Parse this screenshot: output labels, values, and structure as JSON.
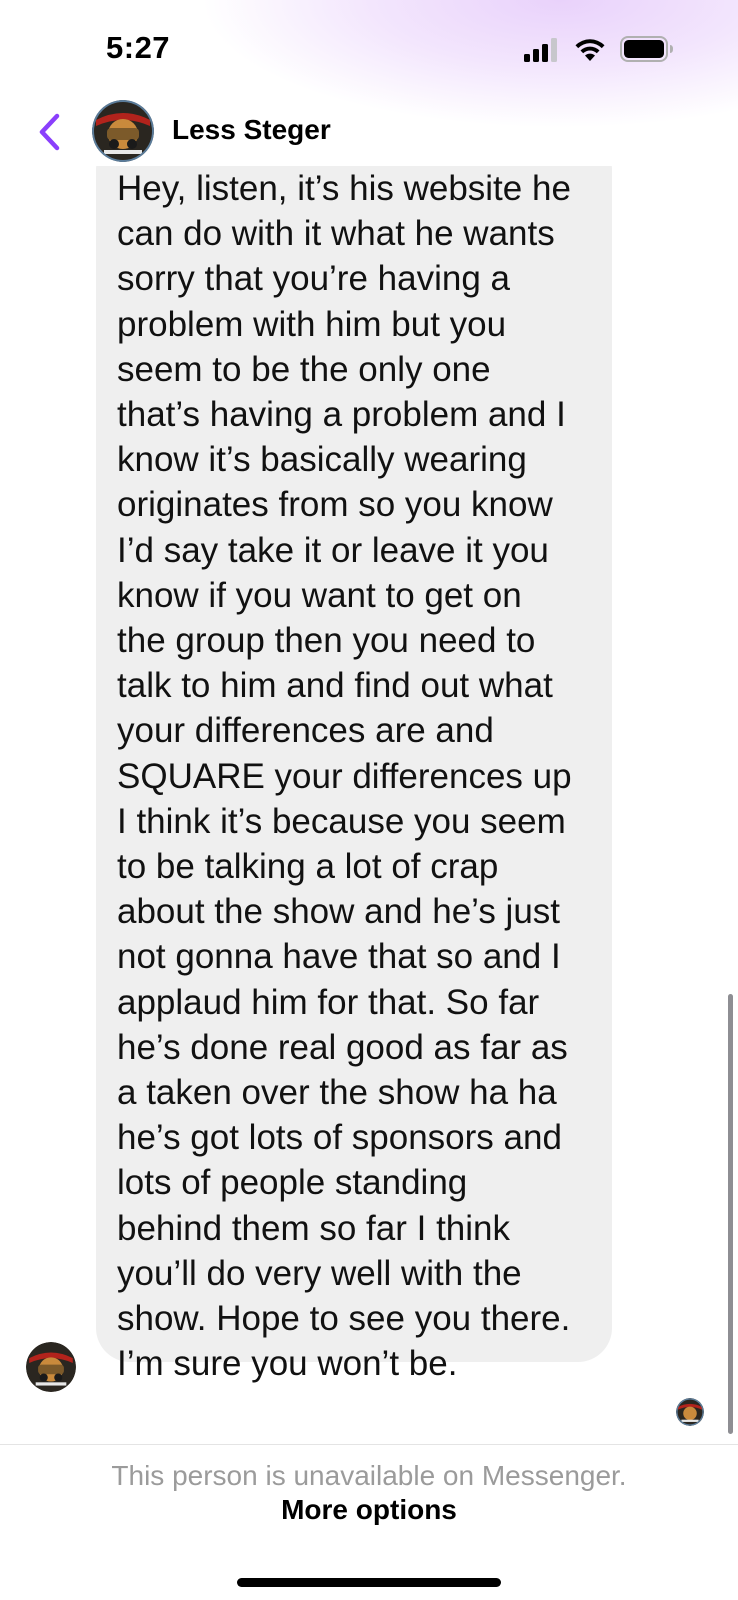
{
  "status_bar": {
    "time": "5:27",
    "icons": [
      "signal-icon",
      "wifi-icon",
      "battery-icon"
    ]
  },
  "header": {
    "back_icon": "chevron-left-icon",
    "contact_name": "Less Steger",
    "accent_color": "#8a3ffc"
  },
  "message": {
    "direction": "incoming",
    "bubble_color": "#efefef",
    "text": "Hey, listen, it’s his website he\ncan do with it what he wants\nsorry that you’re having a\nproblem with him but you\nseem to be the only one\nthat’s having a problem and I\nknow it’s basically wearing\noriginates from so you know\nI’d say take it or leave it you\nknow if you want to get on\nthe group then you need to\ntalk to him and find out what\nyour differences are and\nSQUARE your differences up\nI think it’s because you seem\nto be talking a lot of crap\nabout the show and he’s just\nnot gonna have that so and I\napplaud him for that. So far\nhe’s done real good as far as\na taken over the show ha ha\nhe’s got lots of sponsors and\nlots of people standing\nbehind them so far I think\nyou’ll do very well with the\nshow. Hope to see you there.\nI’m sure you won’t be."
  },
  "footer": {
    "unavailable_text": "This person is unavailable on Messenger.",
    "more_options_label": "More options"
  }
}
